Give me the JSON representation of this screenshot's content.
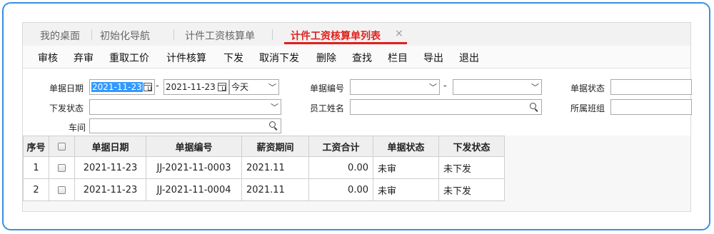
{
  "tabs": [
    {
      "label": "我的桌面"
    },
    {
      "label": "初始化导航"
    },
    {
      "label": "计件工资核算单"
    },
    {
      "label": "计件工资核算单列表",
      "close": "×"
    }
  ],
  "toolbar": {
    "buttons": [
      "审核",
      "弃审",
      "重取工价",
      "计件核算",
      "下发",
      "取消下发",
      "删除",
      "查找",
      "栏目",
      "导出",
      "退出"
    ]
  },
  "filter": {
    "doc_date_label": "单据日期",
    "date_from": "2021-11-23",
    "date_to": "2021-11-23",
    "date_range_dash": "-",
    "date_preset": "今天",
    "doc_no_label": "单据编号",
    "doc_no_from": "",
    "doc_no_dash": "-",
    "doc_no_to": "",
    "doc_status_label": "单据状态",
    "doc_status_value": "",
    "dispatch_status_label": "下发状态",
    "dispatch_status_value": "",
    "employee_label": "员工姓名",
    "employee_value": "",
    "team_label": "所属班组",
    "team_value": "",
    "workshop_label": "车间",
    "workshop_value": ""
  },
  "table": {
    "headers": [
      "序号",
      "",
      "单据日期",
      "单据编号",
      "薪资期间",
      "工资合计",
      "单据状态",
      "下发状态"
    ],
    "rows": [
      [
        "1",
        "",
        "2021-11-23",
        "JJ-2021-11-0003",
        "2021.11",
        "0.00",
        "未审",
        "未下发"
      ],
      [
        "2",
        "",
        "2021-11-23",
        "JJ-2021-11-0004",
        "2021.11",
        "0.00",
        "未审",
        "未下发"
      ]
    ]
  },
  "colors": {
    "accent_red": "#e0201c",
    "frame_blue": "#3a8fe0",
    "selection_blue": "#3399ff"
  }
}
